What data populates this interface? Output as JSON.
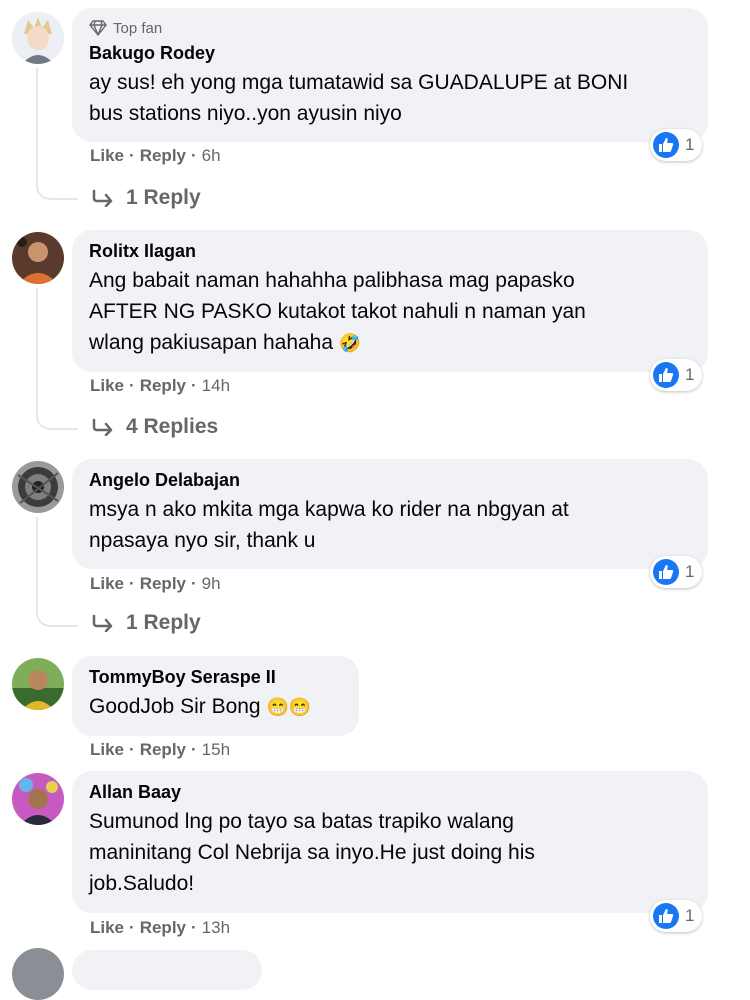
{
  "comments": [
    {
      "badge": "Top fan",
      "author": "Bakugo Rodey",
      "lines": [
        "ay sus! eh yong mga tumatawid sa GUADALUPE at BONI",
        "bus stations niyo..yon ayusin niyo"
      ],
      "like": "Like",
      "reply": "Reply",
      "time": "6h",
      "reaction_count": "1",
      "replies": "1 Reply"
    },
    {
      "author": "Rolitx Ilagan",
      "lines": [
        "Ang babait naman hahahha palibhasa mag papasko",
        "AFTER NG PASKO kutakot takot nahuli n naman yan",
        "wlang pakiusapan hahaha"
      ],
      "emoji": "🤣",
      "like": "Like",
      "reply": "Reply",
      "time": "14h",
      "reaction_count": "1",
      "replies": "4 Replies"
    },
    {
      "author": "Angelo Delabajan",
      "lines": [
        "msya n ako mkita mga kapwa ko rider na nbgyan at",
        "npasaya nyo sir, thank u"
      ],
      "like": "Like",
      "reply": "Reply",
      "time": "9h",
      "reaction_count": "1",
      "replies": "1 Reply"
    },
    {
      "author": "TommyBoy Seraspe II",
      "lines": [
        "GoodJob Sir Bong"
      ],
      "emoji": "😁😁",
      "like": "Like",
      "reply": "Reply",
      "time": "15h"
    },
    {
      "author": "Allan Baay",
      "lines": [
        "Sumunod lng po tayo sa batas trapiko walang",
        "maninitang Col Nebrija sa inyo.He just doing his",
        "job.Saludo!"
      ],
      "like": "Like",
      "reply": "Reply",
      "time": "13h",
      "reaction_count": "1"
    }
  ],
  "colors": {
    "bubble": "#f0f2f5",
    "secondary_text": "#65676b",
    "like_blue": "#1877f2"
  }
}
